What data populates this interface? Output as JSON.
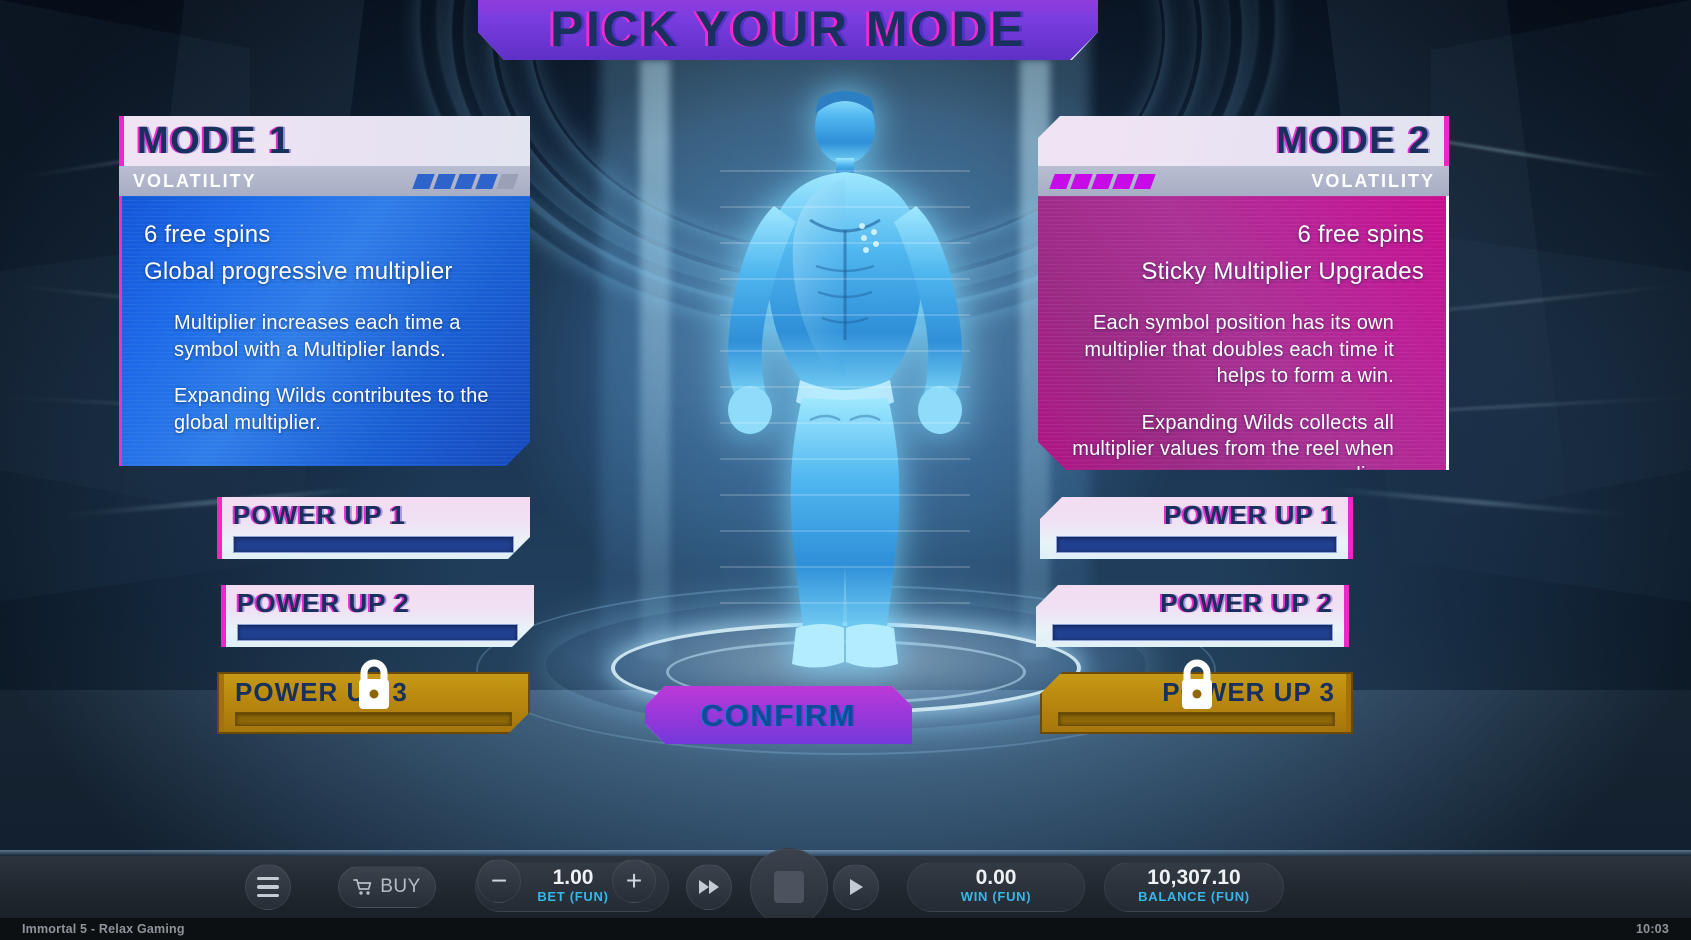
{
  "title": {
    "text": "PICK YOUR MODE"
  },
  "modes": [
    {
      "name": "MODE 1",
      "volatility_label": "VOLATILITY",
      "volatility_filled": 4,
      "volatility_total": 5,
      "accent": "#1c6ae8",
      "bullets": [
        "6 free spins",
        "Global progressive multiplier"
      ],
      "details": [
        "Multiplier increases each time a symbol with a Multiplier lands.",
        "Expanding Wilds contributes to the global multiplier."
      ],
      "powerups": [
        {
          "label": "POWER UP 1",
          "locked": false
        },
        {
          "label": "POWER UP 2",
          "locked": false
        },
        {
          "label": "POWER UP 3",
          "locked": true,
          "lock_icon": "padlock-icon"
        }
      ]
    },
    {
      "name": "MODE 2",
      "volatility_label": "VOLATILITY",
      "volatility_filled": 5,
      "volatility_total": 5,
      "accent": "#c8108f",
      "bullets": [
        "6 free spins",
        "Sticky Multiplier Upgrades"
      ],
      "details": [
        "Each symbol position has its own multiplier that doubles each time it helps to form a win.",
        "Expanding Wilds collects all multiplier values from the reel when expanding."
      ],
      "powerups": [
        {
          "label": "POWER UP 1",
          "locked": false
        },
        {
          "label": "POWER UP 2",
          "locked": false
        },
        {
          "label": "POWER UP 3",
          "locked": true,
          "lock_icon": "padlock-icon"
        }
      ]
    }
  ],
  "confirm": {
    "label": "CONFIRM"
  },
  "toolbar": {
    "menu_icon": "hamburger-menu-icon",
    "buy": {
      "label": "BUY",
      "icon": "shopping-cart-icon"
    },
    "bet": {
      "value": "1.00",
      "caption": "BET (FUN)",
      "minus_icon": "minus-icon",
      "plus_icon": "plus-icon"
    },
    "fast_forward_icon": "fast-forward-icon",
    "stop_icon": "stop-square-icon",
    "play_icon": "play-icon",
    "win": {
      "value": "0.00",
      "caption": "WIN (FUN)"
    },
    "balance": {
      "value": "10,307.10",
      "caption": "BALANCE (FUN)"
    }
  },
  "footer": {
    "game_title": "Immortal 5 - Relax Gaming",
    "clock": "10:03"
  }
}
